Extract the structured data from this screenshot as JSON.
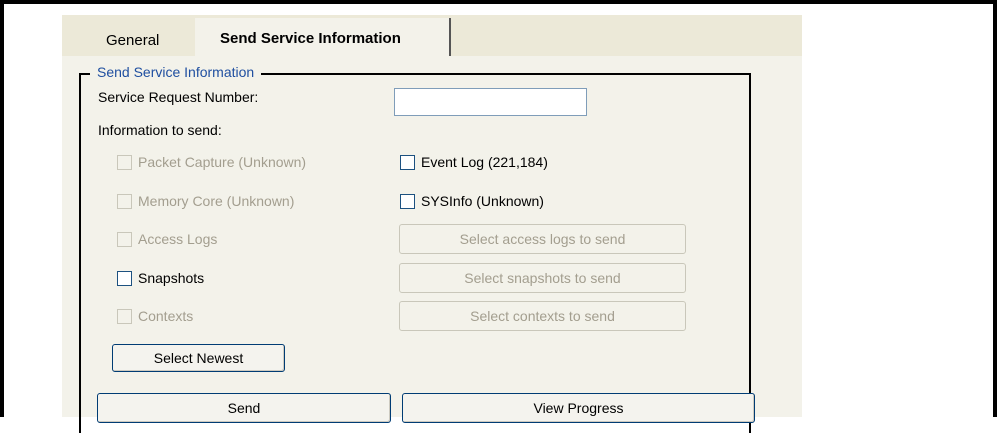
{
  "tabs": [
    {
      "label": "General",
      "active": false
    },
    {
      "label": "Send Service Information",
      "active": true
    }
  ],
  "group": {
    "title": "Send Service Information"
  },
  "service_request": {
    "label": "Service Request Number:",
    "value": ""
  },
  "info_label": "Information to send:",
  "checks": {
    "packet_capture": {
      "label": "Packet Capture (Unknown)",
      "checked": false,
      "enabled": false
    },
    "memory_core": {
      "label": "Memory Core (Unknown)",
      "checked": false,
      "enabled": false
    },
    "access_logs": {
      "label": "Access Logs",
      "checked": false,
      "enabled": false
    },
    "snapshots": {
      "label": "Snapshots",
      "checked": false,
      "enabled": true
    },
    "contexts": {
      "label": "Contexts",
      "checked": false,
      "enabled": false
    },
    "event_log": {
      "label": "Event Log (221,184)",
      "checked": false,
      "enabled": true
    },
    "sysinfo": {
      "label": "SYSInfo (Unknown)",
      "checked": false,
      "enabled": true
    }
  },
  "buttons": {
    "select_access_logs": "Select access logs to send",
    "select_snapshots": "Select snapshots to send",
    "select_contexts": "Select contexts to send",
    "select_newest": "Select Newest",
    "send": "Send",
    "view_progress": "View Progress"
  },
  "colors": {
    "dialog_bg": "#ece9d8",
    "panel_bg": "#f3f2ea",
    "group_title": "#1f4fa0",
    "disabled_text": "#a39e8f",
    "checkbox_border": "#1c5180",
    "button_border": "#003c74"
  }
}
